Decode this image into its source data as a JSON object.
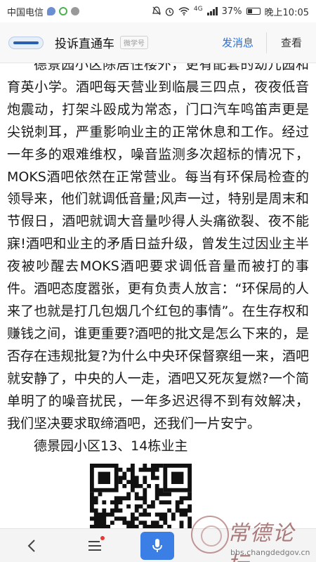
{
  "status_bar": {
    "carrier": "中国电信",
    "network": "4G",
    "battery": "37%",
    "time": "晚上10:05",
    "icons": [
      "chat-icon",
      "ring-icon",
      "dot-icon",
      "signal-icon",
      "mute-icon",
      "alarm-icon",
      "wifi-icon",
      "battery-icon"
    ]
  },
  "header": {
    "title": "投诉直通车",
    "tag": "微学号",
    "send_label": "发消息",
    "view_label": "查看"
  },
  "article": {
    "body": "德景园小区除居住楼外，更有配套的幼儿园和育英小学。酒吧每天营业到临晨三四点，夜夜低音炮震动，打架斗殴成为常态，门口汽车鸣笛声更是尖锐刺耳，严重影响业主的正常休息和工作。经过一年多的艰难维权，噪音监测多次超标的情况下，MOKS酒吧依然在正常营业。每当有环保局检查的领导来，他们就调低音量;风声一过，特别是周末和节假日，酒吧就调大音量吵得人头痛欲裂、夜不能寐!酒吧和业主的矛盾日益升级，曾发生过因业主半夜被吵醒去MOKS酒吧要求调低音量而被打的事件。酒吧态度嚣张，更有负责人放言：“环保局的人来了也就是打几包烟几个红包的事情”。在生存权和赚钱之间，谁更重要?酒吧的批文是怎么下来的，是否存在违规批复?为什么中央环保督察组一来，酒吧就安静了，中央的人一走，酒吧又死灰复燃?一个简单明了的噪音扰民，一年多迟迟得不到有效解决，我们坚决要求取缔酒吧，还我们一片安宁。",
    "signature": "德景园小区13、14栋业主"
  },
  "bottom_bar": {
    "icons": [
      "back-icon",
      "menu-icon",
      "mic-icon"
    ]
  },
  "watermark": {
    "text": "常德论坛",
    "url": "bbs.changdedgov.cn"
  },
  "colors": {
    "accent": "#2d6fd6",
    "mic": "#3a7ee6",
    "badge": "#e53935"
  }
}
